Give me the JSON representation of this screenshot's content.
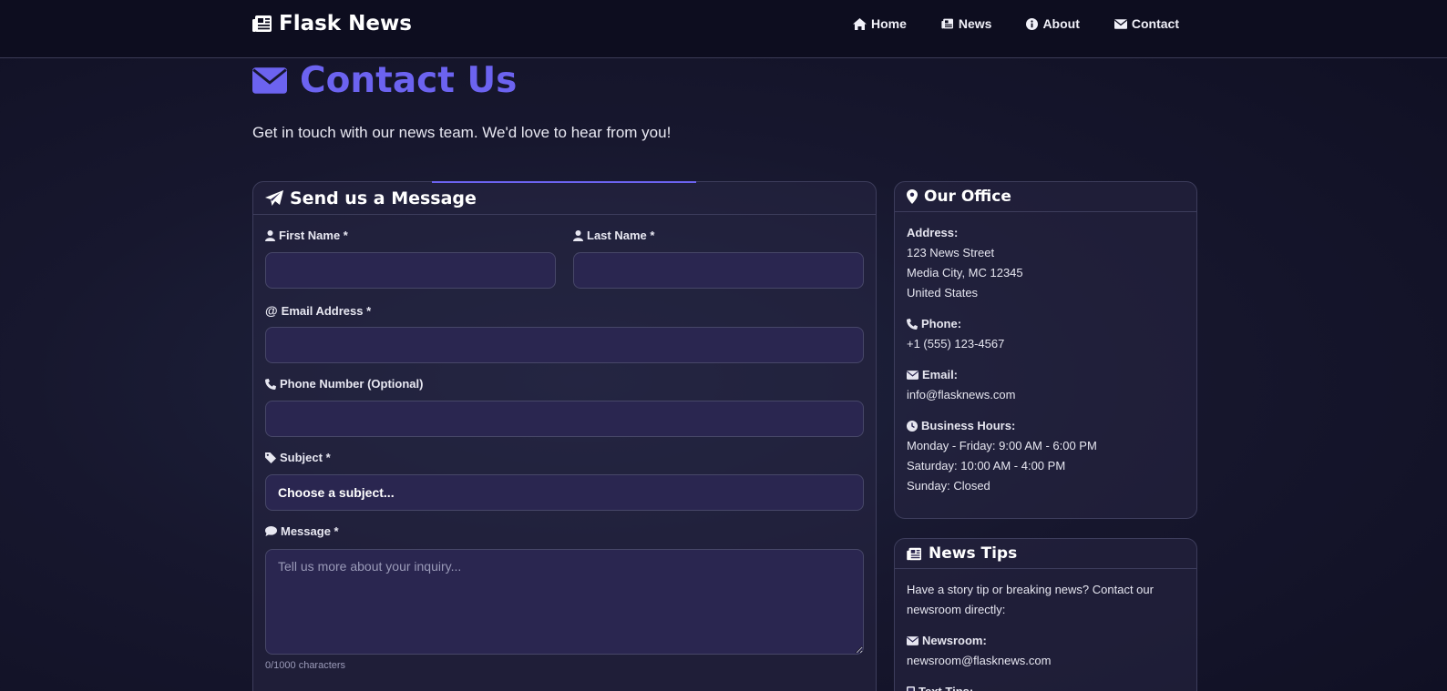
{
  "navbar": {
    "brand": "Flask News",
    "items": [
      {
        "label": "Home",
        "icon": "home-icon"
      },
      {
        "label": "News",
        "icon": "newspaper-icon"
      },
      {
        "label": "About",
        "icon": "info-icon"
      },
      {
        "label": "Contact",
        "icon": "envelope-icon"
      }
    ]
  },
  "page": {
    "title": "Contact Us",
    "subtitle": "Get in touch with our news team. We'd love to hear from you!"
  },
  "form": {
    "header": "Send us a Message",
    "first_name_label": "First Name *",
    "last_name_label": "Last Name *",
    "email_label": "Email Address *",
    "phone_label": "Phone Number (Optional)",
    "subject_label": "Subject *",
    "subject_value": "Choose a subject...",
    "message_label": "Message *",
    "message_placeholder": "Tell us more about your inquiry...",
    "char_count": "0/1000 characters"
  },
  "office": {
    "header": "Our Office",
    "address_label": "Address:",
    "address_lines": [
      "123 News Street",
      "Media City, MC 12345",
      "United States"
    ],
    "phone_label": "Phone:",
    "phone_value": "+1 (555) 123-4567",
    "email_label": "Email:",
    "email_value": "info@flasknews.com",
    "hours_label": "Business Hours:",
    "hours_lines": [
      "Monday - Friday: 9:00 AM - 6:00 PM",
      "Saturday: 10:00 AM - 4:00 PM",
      "Sunday: Closed"
    ]
  },
  "tips": {
    "header": "News Tips",
    "intro": "Have a story tip or breaking news? Contact our newsroom directly:",
    "newsroom_label": "Newsroom:",
    "newsroom_value": "newsroom@flasknews.com",
    "text_label": "Text Tips:"
  },
  "colors": {
    "accent": "#6c63f0",
    "navbar_bg": "#0d0d1f",
    "input_bg": "#2a2650"
  }
}
